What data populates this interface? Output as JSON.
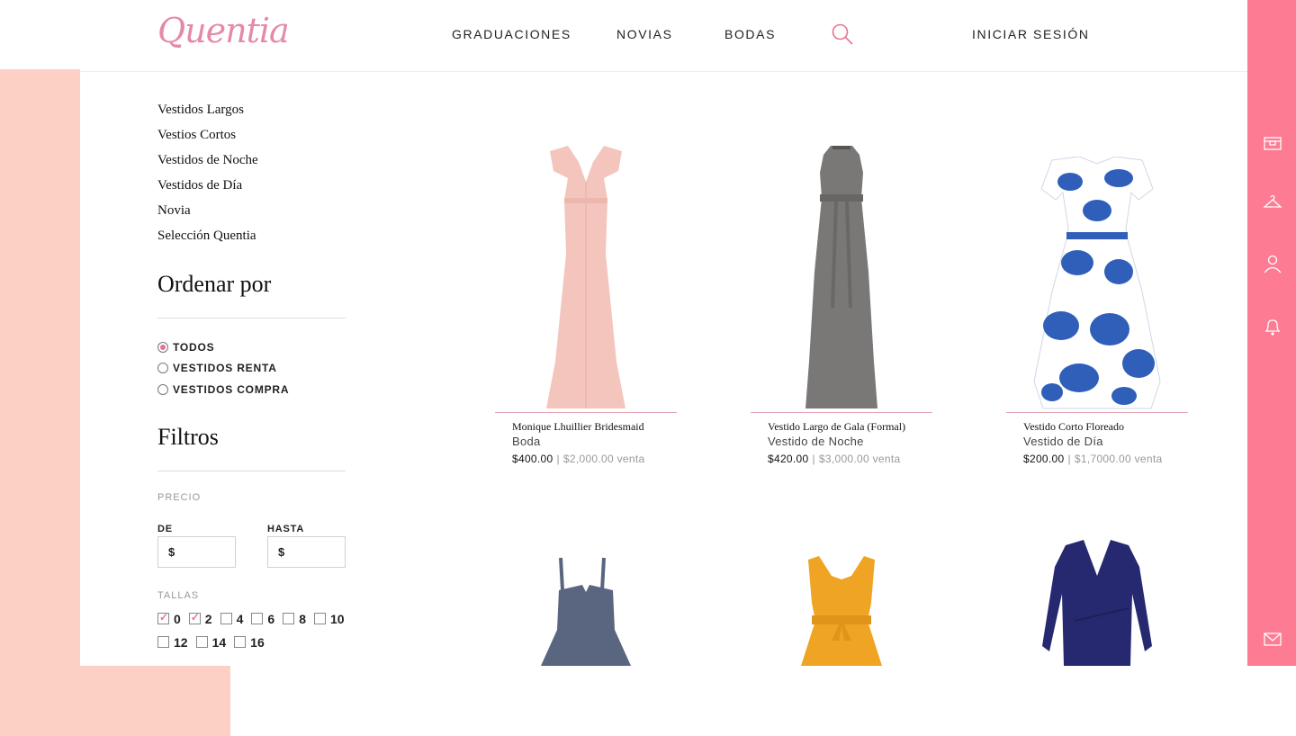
{
  "brand": {
    "logo_text": "Quentia",
    "accent": "#e8738f",
    "rail_color": "#fd7b93",
    "bg_pink": "#fdd0c6"
  },
  "nav": {
    "items": [
      "GRADUACIONES",
      "NOVIAS",
      "BODAS"
    ],
    "login": "INICIAR SESIÓN"
  },
  "sidebar": {
    "categories": [
      "Vestidos Largos",
      "Vestios Cortos",
      "Vestidos de Noche",
      "Vestidos de Día",
      "Novia",
      "Selección Quentia"
    ],
    "sort_title": "Ordenar por",
    "sort_options": [
      {
        "label": "TODOS",
        "selected": true
      },
      {
        "label": "VESTIDOS RENTA",
        "selected": false
      },
      {
        "label": "VESTIDOS COMPRA",
        "selected": false
      }
    ],
    "filters_title": "Filtros",
    "price_label": "PRECIO",
    "from_label": "DE",
    "to_label": "HASTA",
    "from_value": "$",
    "to_value": "$",
    "sizes_label": "TALLAS",
    "sizes": [
      {
        "label": "0",
        "checked": true
      },
      {
        "label": "2",
        "checked": true
      },
      {
        "label": "4",
        "checked": false
      },
      {
        "label": "6",
        "checked": false
      },
      {
        "label": "8",
        "checked": false
      },
      {
        "label": "10",
        "checked": false
      },
      {
        "label": "12",
        "checked": false
      },
      {
        "label": "14",
        "checked": false
      },
      {
        "label": "16",
        "checked": false
      }
    ]
  },
  "products": [
    {
      "name": "Monique Lhuillier Bridesmaid",
      "category": "Boda",
      "rent": "$400.00",
      "sale": "$2,000.00 venta",
      "color": "#f3c5bd"
    },
    {
      "name": "Vestido Largo de Gala (Formal)",
      "category": "Vestido de Noche",
      "rent": "$420.00",
      "sale": "$3,000.00 venta",
      "color": "#7a7777"
    },
    {
      "name": "Vestido Corto Floreado",
      "category": "Vestido de Día",
      "rent": "$200.00",
      "sale": "$1,7000.00 venta",
      "color": "#2f5fb8"
    },
    {
      "color": "#5a6580"
    },
    {
      "color": "#f0a423"
    },
    {
      "color": "#26296f"
    }
  ],
  "rail_icons": [
    "box-icon",
    "hanger-icon",
    "user-icon",
    "bell-icon",
    "mail-icon"
  ]
}
